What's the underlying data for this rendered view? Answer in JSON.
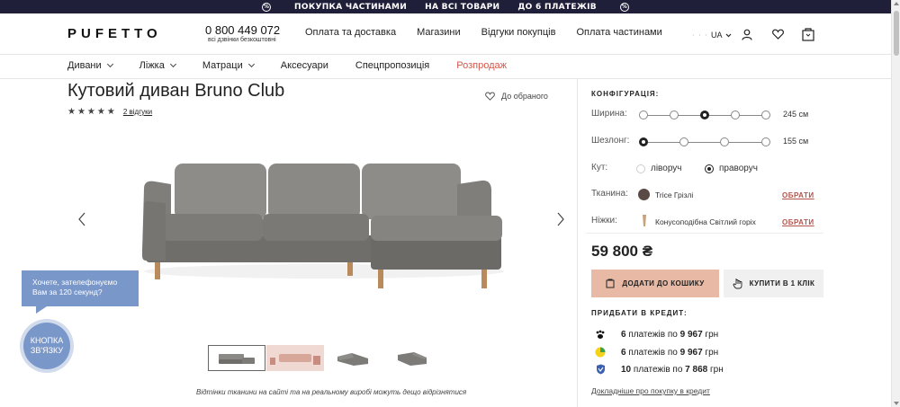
{
  "promo": {
    "items": [
      "ПОКУПКА ЧАСТИНАМИ",
      "НА ВСІ ТОВАРИ",
      "ДО 6 ПЛАТЕЖІВ"
    ],
    "badge": "%"
  },
  "header": {
    "logo": "PUFETTO",
    "phone": "0 800 449 072",
    "phone_note": "всі дзвінки безкоштовні",
    "nav": [
      "Оплата та доставка",
      "Магазини",
      "Відгуки покупців",
      "Оплата частинами"
    ],
    "dots": "· · ·",
    "lang": "UA"
  },
  "catnav": {
    "items": [
      "Дивани",
      "Ліжка",
      "Матраци",
      "Аксесуари",
      "Спецпропозиція",
      "Розпродаж"
    ]
  },
  "product": {
    "title": "Кутовий диван Bruno Club",
    "stars": "★★★★★",
    "reviews": "2 відгуки",
    "favorite": "До обраного",
    "disclaimer": "Відтінки тканини на сайті та на реальному виробі можуть дещо відрізнятися",
    "thumb_count": 4
  },
  "callback": {
    "bubble": "Хочете, зателефонуємо Вам за 120 секунд?",
    "button": "КНОПКА ЗВ'ЯЗКУ"
  },
  "config": {
    "title": "КОНФІГУРАЦІЯ:",
    "width_label": "Ширина:",
    "width_value": "245 см",
    "width_selected_index": 2,
    "chaise_label": "Шезлонг:",
    "chaise_value": "155 см",
    "chaise_selected_index": 0,
    "corner_label": "Кут:",
    "corner_left": "ліворуч",
    "corner_right": "праворуч",
    "fabric_label": "Тканина:",
    "fabric_name": "Trice Грізлі",
    "legs_label": "Ніжки:",
    "legs_name": "Конусоподібна Світлий горіх",
    "choose": "ОБРАТИ",
    "price": "59 800 ₴",
    "add_to_cart": "ДОДАТИ ДО КОШИКУ",
    "buy_1click": "КУПИТИ В 1 КЛІК"
  },
  "credit": {
    "title": "ПРИДБАТИ В КРЕДИТ:",
    "rows": [
      {
        "count": "6",
        "text": " платежів по ",
        "amount": "9 967",
        "currency": " грн"
      },
      {
        "count": "6",
        "text": " платежів по ",
        "amount": "9 967",
        "currency": " грн"
      },
      {
        "count": "10",
        "text": " платежів по ",
        "amount": "7 868",
        "currency": " грн"
      }
    ],
    "link": "Докладніше про покупку в кредит"
  },
  "colors": {
    "promo_bg": "#1f1f3a",
    "sale": "#d4574a",
    "cart_btn": "#e8b9a5",
    "choose": "#b5524a",
    "callback": "#7a97c9",
    "fabric": "#5a4a45",
    "legs": "#c9a27a"
  }
}
